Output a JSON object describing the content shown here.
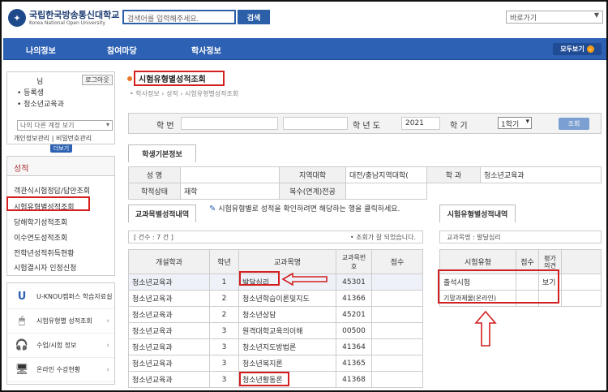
{
  "header": {
    "logo_line1": "국립한국방송통신대학교",
    "logo_line2": "Korea National Open University",
    "search_placeholder": "검색어를 입력해주세요.",
    "search_button": "검색",
    "quick_select": "바로가기"
  },
  "nav": {
    "items": [
      "나의정보",
      "참여마당",
      "학사정보"
    ],
    "all_label": "모두보기"
  },
  "user": {
    "name_suffix": "님",
    "logout": "로그아웃",
    "status": "• 등록생",
    "dept": "• 청소년교육과",
    "account_select": "나의 다른 계정 보기",
    "link1": "개인정보관리",
    "link2": "비밀번호관리",
    "more": "더보기"
  },
  "menu": {
    "head": "성적",
    "items": [
      "객관식시험정답/답안조회",
      "시험유형별성적조회",
      "당해학기성적조회",
      "이수연도성적조회",
      "전학년성적취득현황",
      "시험결시자 인정신청"
    ]
  },
  "shortcuts": [
    {
      "label": "U-KNOU캠퍼스 학습자료실"
    },
    {
      "label": "시험유형별 성적조회"
    },
    {
      "label": "수업/시험 정보"
    },
    {
      "label": "온라인 수강현황"
    }
  ],
  "page": {
    "title": "시험유형별성적조회",
    "breadcrumb": "• 학사정보 › 성적 › 시험유형별성적조회"
  },
  "search": {
    "student_no": "학 번",
    "year_label": "학 년 도",
    "year_value": "2021",
    "term_label": "학 기",
    "term_value": "1학기",
    "button": "조회"
  },
  "basic": {
    "tab": "학생기본정보",
    "name": "성 명",
    "region_label": "지역대학",
    "region_value": "대전/충남지역대학(",
    "dept_label": "학 과",
    "dept_value": "청소년교육과",
    "status_label": "학적상태",
    "status_value": "재학",
    "double_label": "복수(연계)전공"
  },
  "hint": "시험유형별로 성적을 확인하려면 해당하는 행을 클릭하세요.",
  "courses": {
    "tab": "교과목별성적내역",
    "count": "[ 건수 : 7 건 ]",
    "done": "• 조회가 잘 되었습니다.",
    "headers": [
      "개설학과",
      "학년",
      "교과목명",
      "교과목번호",
      "점수"
    ],
    "rows": [
      {
        "dept": "청소년교육과",
        "year": "1",
        "name": "발달심리",
        "code": "45301",
        "score": ""
      },
      {
        "dept": "청소년교육과",
        "year": "2",
        "name": "청소년학습이론및지도",
        "code": "41366",
        "score": ""
      },
      {
        "dept": "청소년교육과",
        "year": "2",
        "name": "청소년상담",
        "code": "45201",
        "score": ""
      },
      {
        "dept": "청소년교육과",
        "year": "3",
        "name": "원격대학교육의이해",
        "code": "00500",
        "score": ""
      },
      {
        "dept": "청소년교육과",
        "year": "3",
        "name": "청소년지도방법론",
        "code": "41364",
        "score": ""
      },
      {
        "dept": "청소년교육과",
        "year": "3",
        "name": "청소년복지론",
        "code": "41365",
        "score": ""
      },
      {
        "dept": "청소년교육과",
        "year": "3",
        "name": "청소년활동론",
        "code": "41368",
        "score": ""
      }
    ]
  },
  "exam": {
    "tab": "시험유형별성적내역",
    "subject": "교과목명 : 발달심리",
    "headers": [
      "시험유형",
      "점수",
      "평가의견"
    ],
    "rows": [
      {
        "type": "출석시험",
        "score": "",
        "opinion": "보기"
      },
      {
        "type": "기말과제물(온라인)",
        "score": "",
        "opinion": ""
      }
    ]
  }
}
